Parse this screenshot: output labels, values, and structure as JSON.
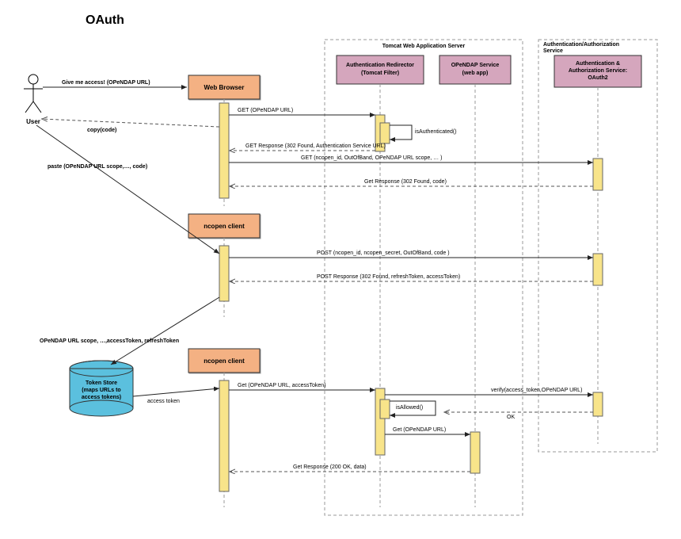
{
  "title": "OAuth",
  "actors": {
    "user": "User",
    "browser": "Web Browser",
    "ncopen1": "ncopen client",
    "ncopen2": "ncopen client",
    "tokenStore": "Token Store (maps URLs to access tokens)",
    "tomcatBox": "Tomcat Web Application Server",
    "authRedirector": "Authentication Redirector (Tomcat Filter)",
    "opendapService": "OPeNDAP Service (web app)",
    "authBox": "Authentication/Authorization Service",
    "authService": "Authentication & Authorization Service: OAuth2"
  },
  "messages": {
    "m1": "Give me access!  (OPeNDAP URL)",
    "m2": "GET (OPeNDAP URL)",
    "m3": "isAuthenticated()",
    "m4": "GET Response (302 Found, Authentication Service URL)",
    "m5": "GET (ncopen_id,  OutOfBand,  OPeNDAP URL scope, … )",
    "m6": "Get Response (302 Found, code)",
    "m7": "copy(code)",
    "m8": "paste (OPeNDAP URL scope,…, code)",
    "m9": "POST (ncopen_id, ncopen_secret, OutOfBand, code )",
    "m10": "POST Response (302 Found, refreshToken, accessToken)",
    "m11": "OPeNDAP URL scope, …,accessToken, refreshToken",
    "m12": "access token",
    "m13": "Get (OPeNDAP URL, accessToken)",
    "m14": "verify(access_token,OPeNDAP URL)",
    "m15": "isAllowed()",
    "m16": "OK",
    "m17": "Get (OPeNDAP URL)",
    "m18": "Get Response (200 OK, data)"
  },
  "chart_data": {
    "type": "sequence-diagram",
    "lifelines": [
      "User",
      "Web Browser",
      "ncopen client",
      "Token Store",
      "Authentication Redirector (Tomcat Filter)",
      "OPeNDAP Service (web app)",
      "Authentication & Authorization Service: OAuth2"
    ],
    "containers": [
      {
        "name": "Tomcat Web Application Server",
        "contains": [
          "Authentication Redirector (Tomcat Filter)",
          "OPeNDAP Service (web app)"
        ]
      },
      {
        "name": "Authentication/Authorization Service",
        "contains": [
          "Authentication & Authorization Service: OAuth2"
        ]
      }
    ],
    "messages": [
      {
        "from": "User",
        "to": "Web Browser",
        "label": "Give me access!  (OPeNDAP URL)",
        "type": "sync"
      },
      {
        "from": "Web Browser",
        "to": "Authentication Redirector (Tomcat Filter)",
        "label": "GET (OPeNDAP URL)",
        "type": "sync"
      },
      {
        "from": "Authentication Redirector (Tomcat Filter)",
        "to": "Authentication Redirector (Tomcat Filter)",
        "label": "isAuthenticated()",
        "type": "self"
      },
      {
        "from": "Authentication Redirector (Tomcat Filter)",
        "to": "Web Browser",
        "label": "GET Response (302 Found, Authentication Service URL)",
        "type": "return"
      },
      {
        "from": "Web Browser",
        "to": "Authentication & Authorization Service: OAuth2",
        "label": "GET (ncopen_id,  OutOfBand,  OPeNDAP URL scope, … )",
        "type": "sync"
      },
      {
        "from": "Authentication & Authorization Service: OAuth2",
        "to": "Web Browser",
        "label": "Get Response (302 Found, code)",
        "type": "return"
      },
      {
        "from": "Web Browser",
        "to": "User",
        "label": "copy(code)",
        "type": "return"
      },
      {
        "from": "User",
        "to": "ncopen client",
        "label": "paste (OPeNDAP URL scope,…, code)",
        "type": "sync"
      },
      {
        "from": "ncopen client",
        "to": "Authentication & Authorization Service: OAuth2",
        "label": "POST (ncopen_id, ncopen_secret, OutOfBand, code )",
        "type": "sync"
      },
      {
        "from": "Authentication & Authorization Service: OAuth2",
        "to": "ncopen client",
        "label": "POST Response (302 Found, refreshToken, accessToken)",
        "type": "return"
      },
      {
        "from": "ncopen client",
        "to": "Token Store",
        "label": "OPeNDAP URL scope, …,accessToken, refreshToken",
        "type": "sync"
      },
      {
        "from": "Token Store",
        "to": "ncopen client",
        "label": "access token",
        "type": "sync"
      },
      {
        "from": "ncopen client",
        "to": "Authentication Redirector (Tomcat Filter)",
        "label": "Get (OPeNDAP URL, accessToken)",
        "type": "sync"
      },
      {
        "from": "Authentication Redirector (Tomcat Filter)",
        "to": "Authentication & Authorization Service: OAuth2",
        "label": "verify(access_token,OPeNDAP URL)",
        "type": "sync"
      },
      {
        "from": "Authentication Redirector (Tomcat Filter)",
        "to": "Authentication Redirector (Tomcat Filter)",
        "label": "isAllowed()",
        "type": "self"
      },
      {
        "from": "Authentication & Authorization Service: OAuth2",
        "to": "Authentication Redirector (Tomcat Filter)",
        "label": "OK",
        "type": "return"
      },
      {
        "from": "Authentication Redirector (Tomcat Filter)",
        "to": "OPeNDAP Service (web app)",
        "label": "Get (OPeNDAP URL)",
        "type": "sync"
      },
      {
        "from": "OPeNDAP Service (web app)",
        "to": "ncopen client",
        "label": "Get Response (200 OK, data)",
        "type": "return"
      }
    ]
  }
}
